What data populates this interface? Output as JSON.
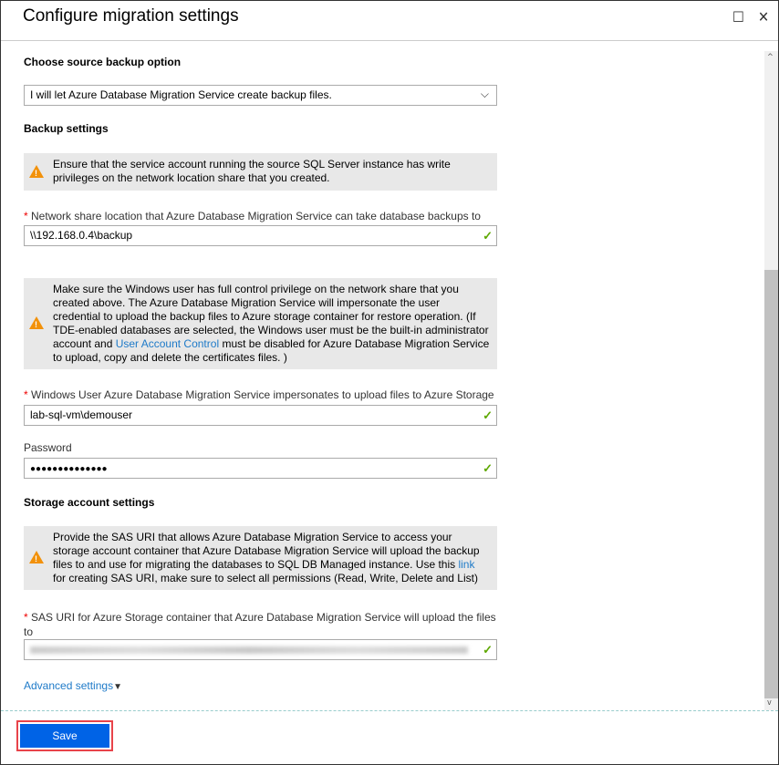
{
  "title": "Configure migration settings",
  "source": {
    "heading": "Choose source backup option",
    "selected": "I will let Azure Database Migration Service create backup files."
  },
  "backup": {
    "heading": "Backup settings",
    "warning1": "Ensure that the service account running the source SQL Server instance has write privileges on the network location share that you created.",
    "share_label": "Network share location that Azure Database Migration Service can take database backups to",
    "share_value": "\\\\192.168.0.4\\backup",
    "warning2_a": "Make sure the Windows user has full control privilege on the network share that you created above. The Azure Database Migration Service will impersonate the user credential to upload the backup files to Azure storage container for restore operation. (If TDE-enabled databases are selected, the Windows user must be the built-in administrator account and ",
    "warning2_link": "User Account Control",
    "warning2_b": " must be disabled for Azure Database Migration Service to upload, copy and delete the certificates files. )",
    "user_label": "Windows User Azure Database Migration Service impersonates to upload files to Azure Storage",
    "user_value": "lab-sql-vm\\demouser",
    "password_label": "Password",
    "password_value": "●●●●●●●●●●●●●●"
  },
  "storage": {
    "heading": "Storage account settings",
    "warning_a": "Provide the SAS URI that allows Azure Database Migration Service to access your storage account container that Azure Database Migration Service will upload the backup files to and use for migrating the databases to SQL DB Managed instance. Use this ",
    "warning_link": "link",
    "warning_b": " for creating SAS URI, make sure to select all permissions (Read, Write, Delete and List)",
    "sas_label": "SAS URI for Azure Storage container that Azure Database Migration Service will upload the files to"
  },
  "advanced": "Advanced settings",
  "save": "Save",
  "colors": {
    "accent": "#0063e6",
    "link": "#1e7ac8",
    "warning": "#f2910a",
    "valid": "#5ea800",
    "highlight": "#e8434a"
  }
}
